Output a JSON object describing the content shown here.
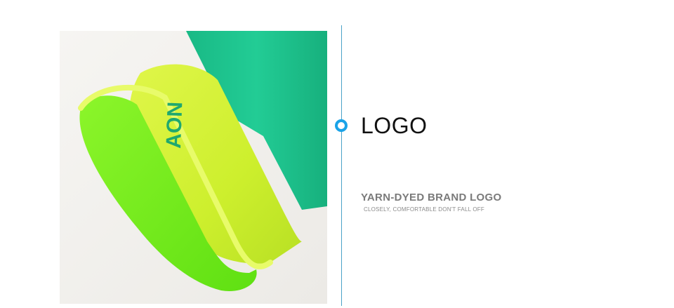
{
  "product_photo": {
    "subject": "sock cuff",
    "colors": {
      "body": "#1fc68f",
      "cuff": "#d4f23a",
      "inner": "#78f21c",
      "background": "#f3f1ee"
    },
    "knit_text": "AON"
  },
  "feature": {
    "title": "LOGO",
    "subtitle": "YARN-DYED BRAND LOGO",
    "caption": "CLOSELY, COMFORTABLE DON'T FALL OFF"
  },
  "accent_color": "#1aa3e8"
}
